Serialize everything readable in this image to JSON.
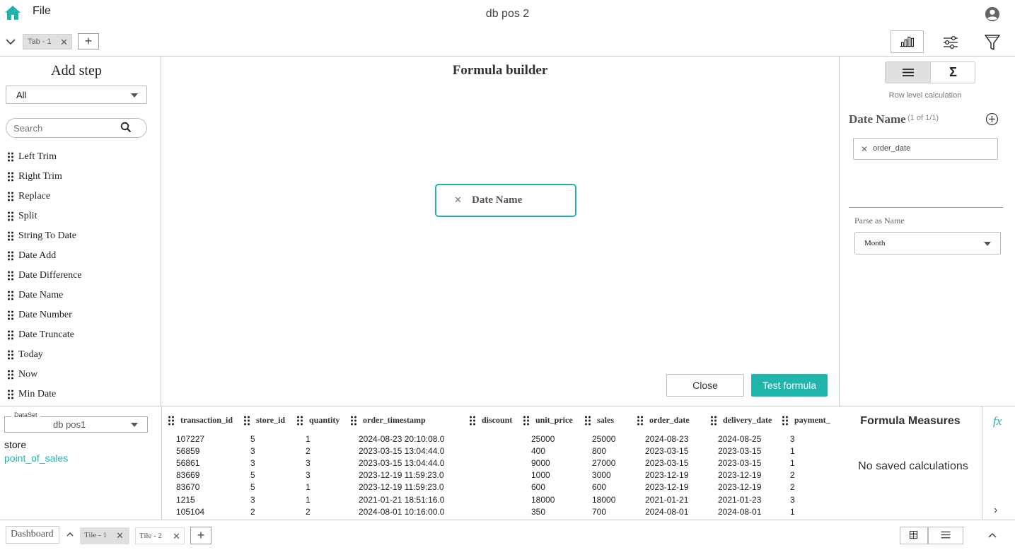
{
  "header": {
    "file_menu": "File",
    "title": "db pos 2"
  },
  "tabs": {
    "items": [
      {
        "label": "Tab - 1"
      }
    ],
    "add_label": "+"
  },
  "left_panel": {
    "title": "Add step",
    "category": "All",
    "search_placeholder": "Search",
    "steps": [
      "Left Trim",
      "Right Trim",
      "Replace",
      "Split",
      "String To Date",
      "Date Add",
      "Date Difference",
      "Date Name",
      "Date Number",
      "Date Truncate",
      "Today",
      "Now",
      "Min Date"
    ]
  },
  "formula": {
    "title": "Formula builder",
    "block_label": "Date Name",
    "close_label": "Close",
    "test_label": "Test formula"
  },
  "right_panel": {
    "sigma": "Σ",
    "calc_mode": "Row level calculation",
    "fn_name": "Date Name",
    "fn_count": "(1 of 1/1)",
    "arg": "order_date",
    "parse_label": "Parse as Name",
    "parse_value": "Month"
  },
  "data": {
    "dataset_legend": "DataSet",
    "dataset": "db pos1",
    "tables": [
      "store",
      "point_of_sales"
    ],
    "columns": [
      "transaction_id",
      "store_id",
      "quantity",
      "order_timestamp",
      "discount",
      "unit_price",
      "sales",
      "order_date",
      "delivery_date",
      "payment_"
    ],
    "rows": [
      [
        "107227",
        "5",
        "1",
        "2024-08-23 20:10:08.0",
        "",
        "25000",
        "25000",
        "2024-08-23",
        "2024-08-25",
        "3"
      ],
      [
        "56859",
        "3",
        "2",
        "2023-03-15 13:04:44.0",
        "",
        "400",
        "800",
        "2023-03-15",
        "2023-03-15",
        "1"
      ],
      [
        "56861",
        "3",
        "3",
        "2023-03-15 13:04:44.0",
        "",
        "9000",
        "27000",
        "2023-03-15",
        "2023-03-15",
        "1"
      ],
      [
        "83669",
        "5",
        "3",
        "2023-12-19 11:59:23.0",
        "",
        "1000",
        "3000",
        "2023-12-19",
        "2023-12-19",
        "2"
      ],
      [
        "83670",
        "5",
        "1",
        "2023-12-19 11:59:23.0",
        "",
        "600",
        "600",
        "2023-12-19",
        "2023-12-19",
        "2"
      ],
      [
        "1215",
        "3",
        "1",
        "2021-01-21 18:51:16.0",
        "",
        "18000",
        "18000",
        "2021-01-21",
        "2021-01-23",
        "3"
      ],
      [
        "105104",
        "2",
        "2",
        "2024-08-01 10:16:00.0",
        "",
        "350",
        "700",
        "2024-08-01",
        "2024-08-01",
        "1"
      ]
    ]
  },
  "measures": {
    "title": "Formula Measures",
    "empty": "No saved calculations"
  },
  "footer": {
    "dashboard": "Dashboard",
    "tiles": [
      "Tile - 1",
      "Tile - 2"
    ],
    "add_label": "+"
  },
  "colors": {
    "accent": "#1fb5ad"
  }
}
